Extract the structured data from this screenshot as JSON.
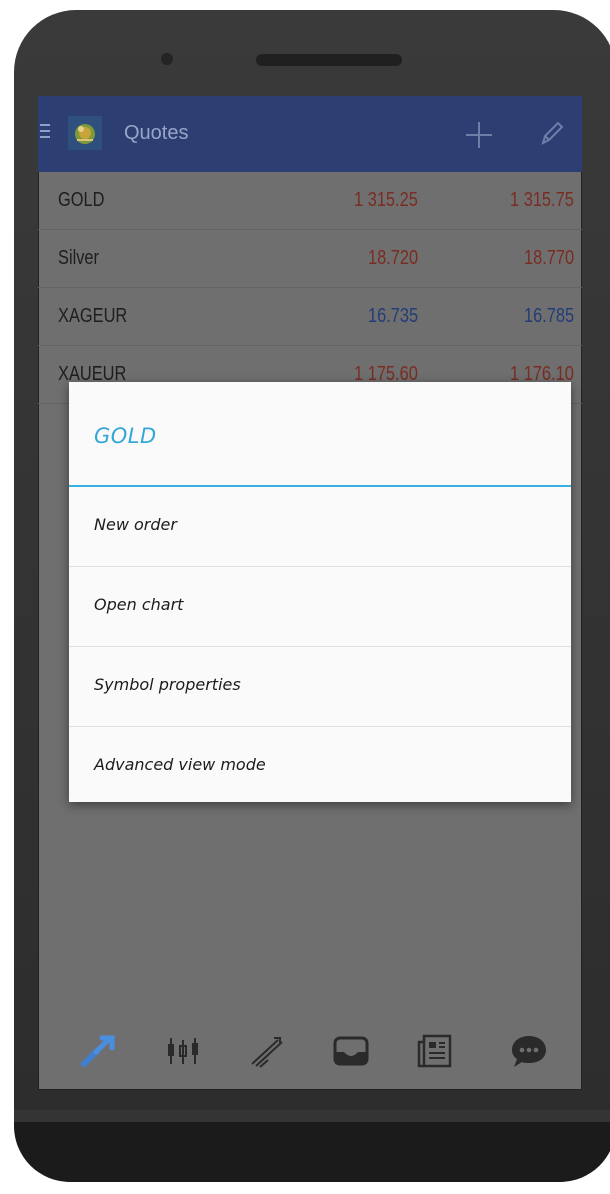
{
  "appbar": {
    "title": "Quotes"
  },
  "quotes": [
    {
      "symbol": "GOLD",
      "bid": "1 315.25",
      "ask": "1 315.75",
      "direction": "down"
    },
    {
      "symbol": "Silver",
      "bid": "18.720",
      "ask": "18.770",
      "direction": "down"
    },
    {
      "symbol": "XAGEUR",
      "bid": "16.735",
      "ask": "16.785",
      "direction": "up"
    },
    {
      "symbol": "XAUEUR",
      "bid": "1 175.60",
      "ask": "1 176.10",
      "direction": "down"
    }
  ],
  "dialog": {
    "title": "GOLD",
    "items": [
      {
        "label": "New order"
      },
      {
        "label": "Open chart"
      },
      {
        "label": "Symbol properties"
      },
      {
        "label": "Advanced view mode"
      }
    ]
  },
  "bottom_nav": {
    "items": [
      "quotes-icon",
      "chart-icon",
      "trade-icon",
      "history-icon",
      "news-icon",
      "chat-icon"
    ],
    "active": "quotes-icon"
  },
  "colors": {
    "accent": "#39b0df",
    "appbar": "#2c3e72",
    "price_down": "#7a2c22",
    "price_up": "#233c78"
  }
}
